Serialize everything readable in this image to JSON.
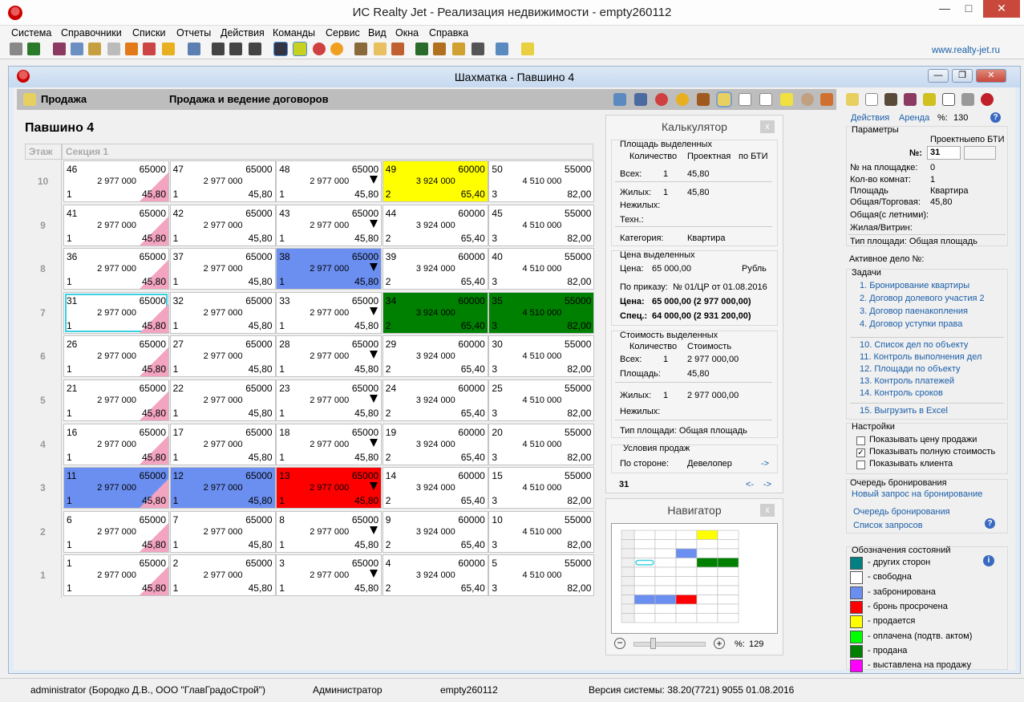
{
  "app": {
    "title": "ИС Realty Jet - Реализация недвижимости - empty260112",
    "weblink": "www.realty-jet.ru"
  },
  "menu": [
    "Система",
    "Справочники",
    "Списки",
    "Отчеты",
    "Действия",
    "Команды",
    "Сервис",
    "Вид",
    "Окна",
    "Справка"
  ],
  "child": {
    "title": "Шахматка - Павшино 4"
  },
  "header": {
    "mode": "Продажа",
    "subtitle": "Продажа и ведение договоров"
  },
  "grid": {
    "building": "Павшино 4",
    "floor_header": "Этаж",
    "section_header": "Секция 1",
    "floors": [
      {
        "floor": "10",
        "units": [
          {
            "n": "46",
            "price": "65000",
            "total": "2 977 000",
            "rooms": "1",
            "area": "45,80",
            "status": "free",
            "mark": "tri"
          },
          {
            "n": "47",
            "price": "65000",
            "total": "2 977 000",
            "rooms": "1",
            "area": "45,80",
            "status": "free",
            "mark": ""
          },
          {
            "n": "48",
            "price": "65000",
            "total": "2 977 000",
            "rooms": "1",
            "area": "45,80",
            "status": "free",
            "mark": "arr"
          },
          {
            "n": "49",
            "price": "60000",
            "total": "3 924 000",
            "rooms": "2",
            "area": "65,40",
            "status": "selling",
            "mark": ""
          },
          {
            "n": "50",
            "price": "55000",
            "total": "4 510 000",
            "rooms": "3",
            "area": "82,00",
            "status": "free",
            "mark": ""
          }
        ]
      },
      {
        "floor": "9",
        "units": [
          {
            "n": "41",
            "price": "65000",
            "total": "2 977 000",
            "rooms": "1",
            "area": "45,80",
            "status": "free",
            "mark": "tri"
          },
          {
            "n": "42",
            "price": "65000",
            "total": "2 977 000",
            "rooms": "1",
            "area": "45,80",
            "status": "free",
            "mark": ""
          },
          {
            "n": "43",
            "price": "65000",
            "total": "2 977 000",
            "rooms": "1",
            "area": "45,80",
            "status": "free",
            "mark": "arr"
          },
          {
            "n": "44",
            "price": "60000",
            "total": "3 924 000",
            "rooms": "2",
            "area": "65,40",
            "status": "free",
            "mark": ""
          },
          {
            "n": "45",
            "price": "55000",
            "total": "4 510 000",
            "rooms": "3",
            "area": "82,00",
            "status": "free",
            "mark": ""
          }
        ]
      },
      {
        "floor": "8",
        "units": [
          {
            "n": "36",
            "price": "65000",
            "total": "2 977 000",
            "rooms": "1",
            "area": "45,80",
            "status": "free",
            "mark": "tri"
          },
          {
            "n": "37",
            "price": "65000",
            "total": "2 977 000",
            "rooms": "1",
            "area": "45,80",
            "status": "free",
            "mark": ""
          },
          {
            "n": "38",
            "price": "65000",
            "total": "2 977 000",
            "rooms": "1",
            "area": "45,80",
            "status": "booked",
            "mark": "arr"
          },
          {
            "n": "39",
            "price": "60000",
            "total": "3 924 000",
            "rooms": "2",
            "area": "65,40",
            "status": "free",
            "mark": ""
          },
          {
            "n": "40",
            "price": "55000",
            "total": "4 510 000",
            "rooms": "3",
            "area": "82,00",
            "status": "free",
            "mark": ""
          }
        ]
      },
      {
        "floor": "7",
        "units": [
          {
            "n": "31",
            "price": "65000",
            "total": "2 977 000",
            "rooms": "1",
            "area": "45,80",
            "status": "free",
            "mark": "tri",
            "selected": true
          },
          {
            "n": "32",
            "price": "65000",
            "total": "2 977 000",
            "rooms": "1",
            "area": "45,80",
            "status": "free",
            "mark": ""
          },
          {
            "n": "33",
            "price": "65000",
            "total": "2 977 000",
            "rooms": "1",
            "area": "45,80",
            "status": "free",
            "mark": "arr"
          },
          {
            "n": "34",
            "price": "60000",
            "total": "3 924 000",
            "rooms": "2",
            "area": "65,40",
            "status": "sold",
            "mark": ""
          },
          {
            "n": "35",
            "price": "55000",
            "total": "4 510 000",
            "rooms": "3",
            "area": "82,00",
            "status": "sold",
            "mark": ""
          }
        ]
      },
      {
        "floor": "6",
        "units": [
          {
            "n": "26",
            "price": "65000",
            "total": "2 977 000",
            "rooms": "1",
            "area": "45,80",
            "status": "free",
            "mark": "tri"
          },
          {
            "n": "27",
            "price": "65000",
            "total": "2 977 000",
            "rooms": "1",
            "area": "45,80",
            "status": "free",
            "mark": ""
          },
          {
            "n": "28",
            "price": "65000",
            "total": "2 977 000",
            "rooms": "1",
            "area": "45,80",
            "status": "free",
            "mark": "arr"
          },
          {
            "n": "29",
            "price": "60000",
            "total": "3 924 000",
            "rooms": "2",
            "area": "65,40",
            "status": "free",
            "mark": ""
          },
          {
            "n": "30",
            "price": "55000",
            "total": "4 510 000",
            "rooms": "3",
            "area": "82,00",
            "status": "free",
            "mark": ""
          }
        ]
      },
      {
        "floor": "5",
        "units": [
          {
            "n": "21",
            "price": "65000",
            "total": "2 977 000",
            "rooms": "1",
            "area": "45,80",
            "status": "free",
            "mark": "tri"
          },
          {
            "n": "22",
            "price": "65000",
            "total": "2 977 000",
            "rooms": "1",
            "area": "45,80",
            "status": "free",
            "mark": ""
          },
          {
            "n": "23",
            "price": "65000",
            "total": "2 977 000",
            "rooms": "1",
            "area": "45,80",
            "status": "free",
            "mark": "arr"
          },
          {
            "n": "24",
            "price": "60000",
            "total": "3 924 000",
            "rooms": "2",
            "area": "65,40",
            "status": "free",
            "mark": ""
          },
          {
            "n": "25",
            "price": "55000",
            "total": "4 510 000",
            "rooms": "3",
            "area": "82,00",
            "status": "free",
            "mark": ""
          }
        ]
      },
      {
        "floor": "4",
        "units": [
          {
            "n": "16",
            "price": "65000",
            "total": "2 977 000",
            "rooms": "1",
            "area": "45,80",
            "status": "free",
            "mark": "tri"
          },
          {
            "n": "17",
            "price": "65000",
            "total": "2 977 000",
            "rooms": "1",
            "area": "45,80",
            "status": "free",
            "mark": ""
          },
          {
            "n": "18",
            "price": "65000",
            "total": "2 977 000",
            "rooms": "1",
            "area": "45,80",
            "status": "free",
            "mark": "arr"
          },
          {
            "n": "19",
            "price": "60000",
            "total": "3 924 000",
            "rooms": "2",
            "area": "65,40",
            "status": "free",
            "mark": ""
          },
          {
            "n": "20",
            "price": "55000",
            "total": "4 510 000",
            "rooms": "3",
            "area": "82,00",
            "status": "free",
            "mark": ""
          }
        ]
      },
      {
        "floor": "3",
        "units": [
          {
            "n": "11",
            "price": "65000",
            "total": "2 977 000",
            "rooms": "1",
            "area": "45,80",
            "status": "booked",
            "mark": "tri"
          },
          {
            "n": "12",
            "price": "65000",
            "total": "2 977 000",
            "rooms": "1",
            "area": "45,80",
            "status": "booked",
            "mark": ""
          },
          {
            "n": "13",
            "price": "65000",
            "total": "2 977 000",
            "rooms": "1",
            "area": "45,80",
            "status": "overdue",
            "mark": "arr"
          },
          {
            "n": "14",
            "price": "60000",
            "total": "3 924 000",
            "rooms": "2",
            "area": "65,40",
            "status": "free",
            "mark": ""
          },
          {
            "n": "15",
            "price": "55000",
            "total": "4 510 000",
            "rooms": "3",
            "area": "82,00",
            "status": "free",
            "mark": ""
          }
        ]
      },
      {
        "floor": "2",
        "units": [
          {
            "n": "6",
            "price": "65000",
            "total": "2 977 000",
            "rooms": "1",
            "area": "45,80",
            "status": "free",
            "mark": "tri"
          },
          {
            "n": "7",
            "price": "65000",
            "total": "2 977 000",
            "rooms": "1",
            "area": "45,80",
            "status": "free",
            "mark": ""
          },
          {
            "n": "8",
            "price": "65000",
            "total": "2 977 000",
            "rooms": "1",
            "area": "45,80",
            "status": "free",
            "mark": "arr"
          },
          {
            "n": "9",
            "price": "60000",
            "total": "3 924 000",
            "rooms": "2",
            "area": "65,40",
            "status": "free",
            "mark": ""
          },
          {
            "n": "10",
            "price": "55000",
            "total": "4 510 000",
            "rooms": "3",
            "area": "82,00",
            "status": "free",
            "mark": ""
          }
        ]
      },
      {
        "floor": "1",
        "units": [
          {
            "n": "1",
            "price": "65000",
            "total": "2 977 000",
            "rooms": "1",
            "area": "45,80",
            "status": "free",
            "mark": "tri"
          },
          {
            "n": "2",
            "price": "65000",
            "total": "2 977 000",
            "rooms": "1",
            "area": "45,80",
            "status": "free",
            "mark": ""
          },
          {
            "n": "3",
            "price": "65000",
            "total": "2 977 000",
            "rooms": "1",
            "area": "45,80",
            "status": "free",
            "mark": "arr"
          },
          {
            "n": "4",
            "price": "60000",
            "total": "3 924 000",
            "rooms": "2",
            "area": "65,40",
            "status": "free",
            "mark": ""
          },
          {
            "n": "5",
            "price": "55000",
            "total": "4 510 000",
            "rooms": "3",
            "area": "82,00",
            "status": "free",
            "mark": ""
          }
        ]
      }
    ]
  },
  "status_colors": {
    "free": "#ffffff",
    "booked": "#6b8ff0",
    "overdue": "#ff0000",
    "selling": "#ffff00",
    "paid": "#00ff00",
    "sold": "#008000",
    "other": "#008080",
    "listed": "#ff00ff"
  },
  "calc": {
    "title": "Калькулятор",
    "area_group": "Площадь выделенных",
    "col_qty": "Количество",
    "col_proj": "Проектная",
    "col_bti": "по БТИ",
    "all_lbl": "Всех:",
    "all_qty": "1",
    "all_proj": "45,80",
    "living_lbl": "Жилых:",
    "living_qty": "1",
    "living_proj": "45,80",
    "nonliving_lbl": "Нежилых:",
    "tech_lbl": "Техн.:",
    "category_lbl": "Категория:",
    "category_val": "Квартира",
    "price_group": "Цена выделенных",
    "price_lbl": "Цена:",
    "price_val": "65 000,00",
    "price_cur": "Рубль",
    "order_lbl": "По приказу:",
    "order_val": "№ 01/ЦР от 01.08.2016",
    "price2_lbl": "Цена:",
    "price2_val": "65 000,00 (2 977 000,00)",
    "spec_lbl": "Спец.:",
    "spec_val": "64 000,00 (2 931 200,00)",
    "cost_group": "Стоимость выделенных",
    "col_qty2": "Количество",
    "col_cost": "Стоимость",
    "c_all_lbl": "Всех:",
    "c_all_qty": "1",
    "c_all_cost": "2 977 000,00",
    "c_area_lbl": "Площадь:",
    "c_area_val": "45,80",
    "c_living_lbl": "Жилых:",
    "c_living_qty": "1",
    "c_living_cost": "2 977 000,00",
    "c_nonliving_lbl": "Нежилых:",
    "area_type": "Тип площади: Общая площадь",
    "cond_group": "Условия продаж",
    "side_lbl": "По стороне:",
    "side_val": "Девелопер",
    "side_arrow": "->",
    "footer_num": "31",
    "nav_prev": "<-",
    "nav_next": "->"
  },
  "nav": {
    "title": "Навигатор",
    "zoom": "129"
  },
  "right": {
    "tab_actions": "Действия",
    "tab_rent": "Аренда",
    "zoom": "130",
    "params_group": "Параметры",
    "col_proj": "Проектные",
    "col_bti": "по БТИ",
    "no_lbl": "№:",
    "no_val": "31",
    "floor_no_lbl": "№ на площадке:",
    "floor_no_val": "0",
    "rooms_lbl": "Кол-во комнат:",
    "rooms_val": "1",
    "area_lbl": "Площадь",
    "area_val": "Квартира",
    "total_lbl": "Общая/Торговая:",
    "total_val": "45,80",
    "summer_lbl": "Общая(с летними):",
    "living_lbl": "Жилая/Витрин:",
    "area_type": "Тип площади: Общая площадь",
    "active_case": "Активное дело №:",
    "tasks_group": "Задачи",
    "tasks": [
      "1. Бронирование квартиры",
      "2. Договор долевого участия 2",
      "3. Договор паенакопления",
      "4. Договор уступки права"
    ],
    "tasks2": [
      "10. Список дел по объекту",
      "11. Контроль выполнения дел",
      "12. Площади по объекту",
      "13. Контроль платежей",
      "14. Контроль сроков"
    ],
    "export": "15. Выгрузить в Excel",
    "settings_group": "Настройки",
    "settings": [
      {
        "label": "Показывать цену продажи",
        "checked": false
      },
      {
        "label": "Показывать полную стоимость",
        "checked": true
      },
      {
        "label": "Показывать клиента",
        "checked": false
      }
    ],
    "queue_group": "Очередь бронирования",
    "queue_new": "Новый запрос на бронирование",
    "queue_list": "Очередь бронирования",
    "queue_requests": "Список запросов",
    "legend_group": "Обозначения состояний",
    "legend": [
      {
        "label": "- других сторон",
        "color": "#008080"
      },
      {
        "label": "- свободна",
        "color": "#ffffff"
      },
      {
        "label": "- забронирована",
        "color": "#6b8ff0"
      },
      {
        "label": "- бронь просрочена",
        "color": "#ff0000"
      },
      {
        "label": "- продается",
        "color": "#ffff00"
      },
      {
        "label": "- оплачена (подтв. актом)",
        "color": "#00ff00"
      },
      {
        "label": "- продана",
        "color": "#008000"
      },
      {
        "label": "- выставлена на продажу",
        "color": "#ff00ff"
      }
    ]
  },
  "status": {
    "user": "administrator (Бородко Д.В., ООО \"ГлавГрадоСтрой\")",
    "role": "Администратор",
    "db": "empty260112",
    "version": "Версия системы: 38.20(7721) 9055 01.08.2016"
  }
}
